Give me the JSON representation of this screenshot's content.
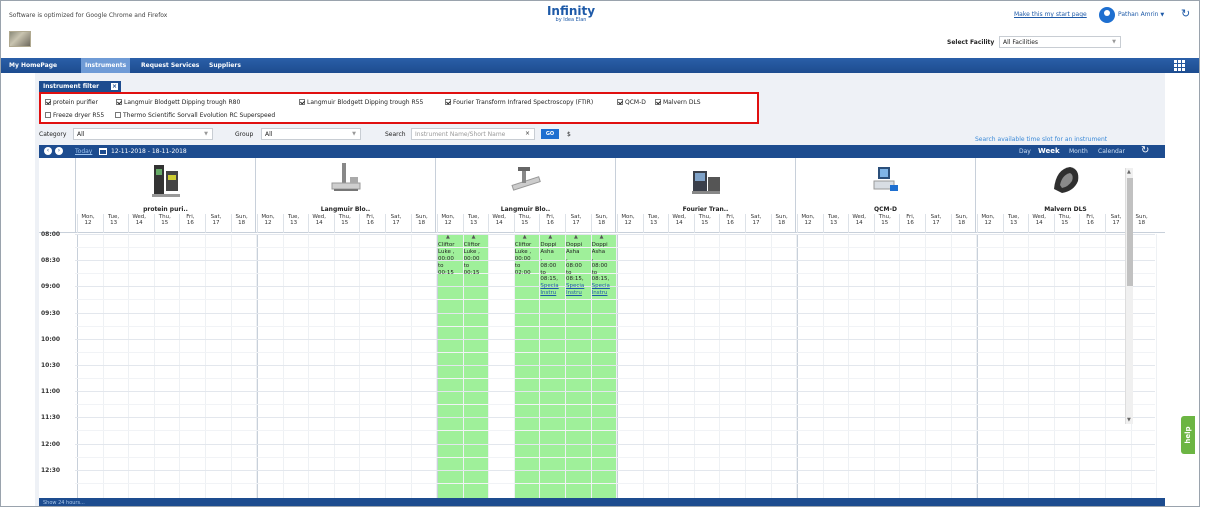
{
  "topbar": {
    "browser_note": "Software is optimized for Google Chrome and Firefox",
    "brand_name": "Infinity",
    "brand_sub": "by Idea Elan",
    "make_start_page": "Make this my start page",
    "user_name": "Pathan Amrin",
    "user_caret": "▼",
    "refresh_glyph": "↻"
  },
  "facility": {
    "label": "Select Facility",
    "value": "All Facilities"
  },
  "nav": {
    "tabs": [
      "My HomePage",
      "Instruments",
      "Request Services",
      "Suppliers"
    ],
    "active_tab": "Instruments"
  },
  "filter": {
    "title": "Instrument filter",
    "close_glyph": "×",
    "items": [
      {
        "label": "protein purifier",
        "checked": true
      },
      {
        "label": "Langmuir Blodgett Dipping trough R80",
        "checked": true
      },
      {
        "label": "Langmuir Blodgett Dipping trough R55",
        "checked": true
      },
      {
        "label": "Fourier Transform Infrared Spectroscopy (FTIR)",
        "checked": true
      },
      {
        "label": "QCM-D",
        "checked": true
      },
      {
        "label": "Malvern DLS",
        "checked": true
      },
      {
        "label": "Freeze dryer R55",
        "checked": false
      },
      {
        "label": "Thermo Scientific Sorvall Evolution RC Superspeed",
        "checked": false
      }
    ]
  },
  "search_row": {
    "category_label": "Category",
    "category_value": "All",
    "group_label": "Group",
    "group_value": "All",
    "search_label": "Search",
    "search_placeholder": "Instrument Name/Short Name",
    "clear_glyph": "×",
    "go_label": "GO",
    "currency": "$",
    "slot_link": "Search available time slot for an instrument"
  },
  "calendar_bar": {
    "today": "Today",
    "date_range": "12-11-2018 - 18-11-2018",
    "views": [
      "Day",
      "Week",
      "Month",
      "Calendar"
    ],
    "active_view": "Week",
    "refresh_glyph": "↻",
    "prev_glyph": "‹",
    "next_glyph": "›"
  },
  "instruments": [
    {
      "name": "protein puri..",
      "icon": "protein-purifier-image"
    },
    {
      "name": "Langmuir Blo..",
      "icon": "langmuir-trough-image"
    },
    {
      "name": "Langmuir Blo..",
      "icon": "langmuir-trough-image"
    },
    {
      "name": "Fourier Tran..",
      "icon": "ftir-image"
    },
    {
      "name": "QCM-D",
      "icon": "qcm-d-image"
    },
    {
      "name": "Malvern DLS",
      "icon": "malvern-dls-image"
    }
  ],
  "days": [
    {
      "dow": "Mon,",
      "date": "12"
    },
    {
      "dow": "Tue,",
      "date": "13"
    },
    {
      "dow": "Wed,",
      "date": "14"
    },
    {
      "dow": "Thu,",
      "date": "15"
    },
    {
      "dow": "Fri,",
      "date": "16"
    },
    {
      "dow": "Sat,",
      "date": "17"
    },
    {
      "dow": "Sun,",
      "date": "18"
    }
  ],
  "times": [
    "08:00",
    "08:30",
    "09:00",
    "09:30",
    "10:00",
    "10:30",
    "11:00",
    "11:30",
    "12:00",
    "12:30"
  ],
  "bookings": [
    {
      "day_index": 0,
      "lines": [
        "Cliftor",
        "Luke ,",
        "00:00",
        "to",
        "00:15"
      ],
      "link": ""
    },
    {
      "day_index": 1,
      "lines": [
        "Cliftor",
        "Luke ,",
        "00:00",
        "to",
        "00:15"
      ],
      "link": ""
    },
    {
      "day_index": 3,
      "lines": [
        "Cliftor",
        "Luke ,",
        "00:00",
        "to",
        "02:00"
      ],
      "link": ""
    },
    {
      "day_index": 4,
      "lines": [
        "Doppi",
        "Asha",
        ",",
        "08:00",
        "to",
        "08:15,"
      ],
      "link_lines": [
        "Specia",
        "Instru"
      ]
    },
    {
      "day_index": 5,
      "lines": [
        "Doppi",
        "Asha",
        ",",
        "08:00",
        "to",
        "08:15,"
      ],
      "link_lines": [
        "Specia",
        "Instru"
      ]
    },
    {
      "day_index": 6,
      "lines": [
        "Doppi",
        "Asha",
        ",",
        "08:00",
        "to",
        "08:15,"
      ],
      "link_lines": [
        "Specia",
        "Instru"
      ]
    }
  ],
  "footer": {
    "show_24": "Show 24 hours..."
  },
  "help": {
    "label": "help"
  },
  "colors": {
    "nav_blue": "#1d4c8f",
    "booking_green": "#9ff09a",
    "filter_outline": "#e01010",
    "help_green": "#6cb543"
  }
}
